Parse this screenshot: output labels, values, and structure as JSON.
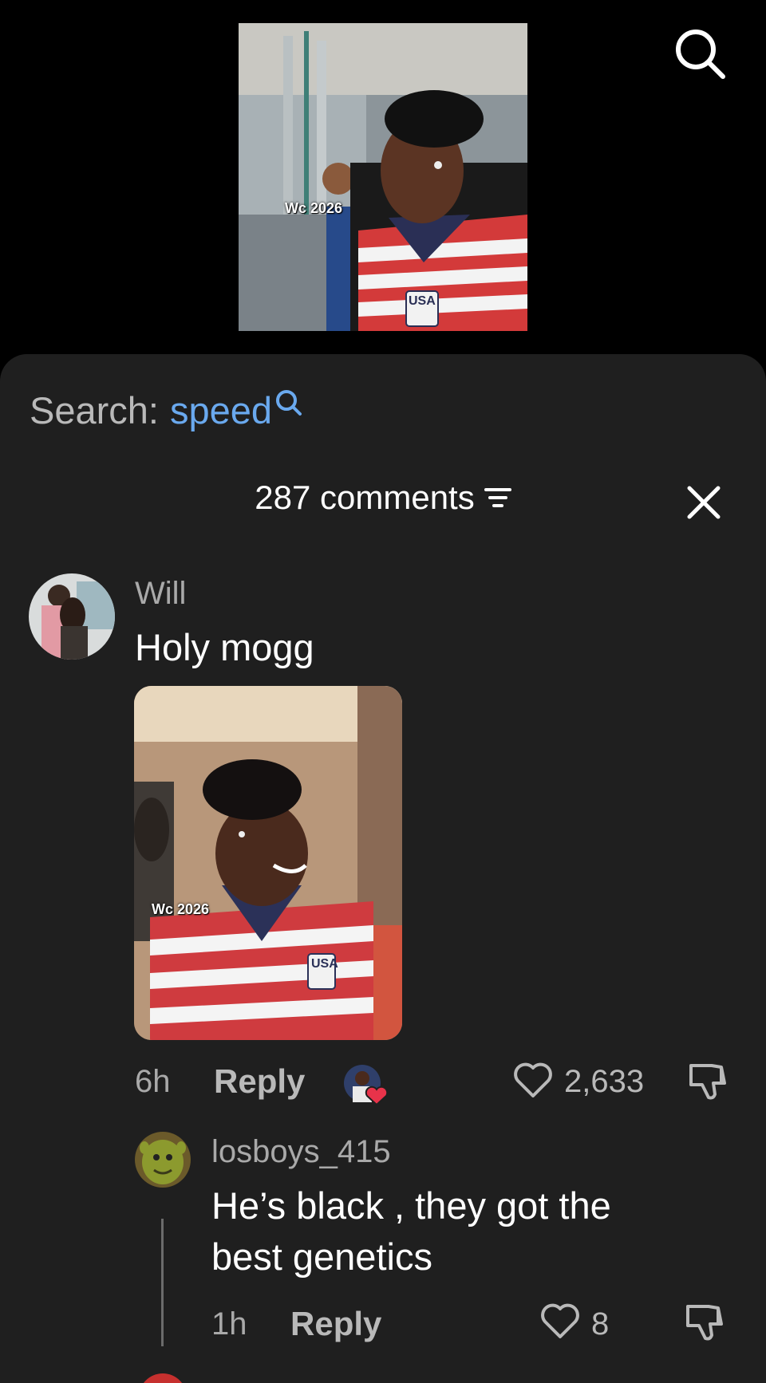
{
  "video": {
    "overlay_text": "Wc 2026",
    "jersey_text": "USA"
  },
  "top_search_icon": "search-icon",
  "search_bar": {
    "prefix": "Search:",
    "term": "speed",
    "icon": "search-icon"
  },
  "comments_header": {
    "count_label": "287 comments",
    "filter_icon": "filter-icon",
    "close_icon": "close-icon"
  },
  "comments": [
    {
      "username": "Will",
      "text": "Holy mogg",
      "image": {
        "overlay_text": "Wc 2026",
        "jersey_text": "USA"
      },
      "time": "6h",
      "reply_label": "Reply",
      "likes": "2,633"
    }
  ],
  "replies": [
    {
      "username": "losboys_415",
      "text_line1": "He’s black , they got the",
      "text_line2": "best genetics",
      "time": "1h",
      "reply_label": "Reply",
      "likes": "8"
    }
  ],
  "colors": {
    "sheet_bg": "#1f1f1f",
    "accent": "#6aa9ee",
    "muted": "#a9a9a9",
    "like_heart": "#e8334a"
  }
}
